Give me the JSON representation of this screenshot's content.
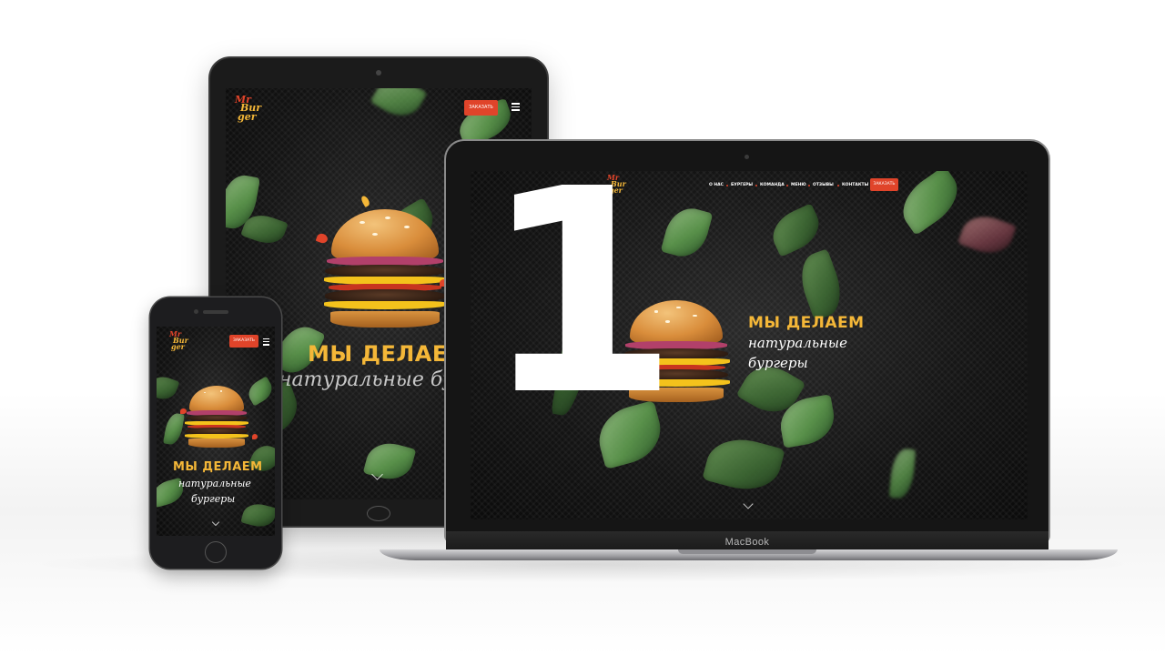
{
  "brand": {
    "logo_line1": "Mr",
    "logo_line2": "Bur",
    "logo_line3": "ger",
    "accent_color": "#f4b738",
    "button_color": "#e0442a"
  },
  "hero": {
    "headline": "МЫ ДЕЛАЕМ",
    "subline1": "натуральные",
    "subline2": "бургеры",
    "tablet_subline": "натуральные бургеры"
  },
  "nav": {
    "items": [
      "О НАС",
      "БУРГЕРЫ",
      "КОМАНДА",
      "МЕНЮ",
      "ОТЗЫВЫ",
      "КОНТАКТЫ"
    ],
    "order_button": "ЗАКАЗАТЬ"
  },
  "devices": {
    "laptop_label": "MacBook"
  },
  "overlay": {
    "number": "1"
  },
  "icons": {
    "menu": "hamburger-menu-icon",
    "scroll": "chevron-down-icon"
  }
}
